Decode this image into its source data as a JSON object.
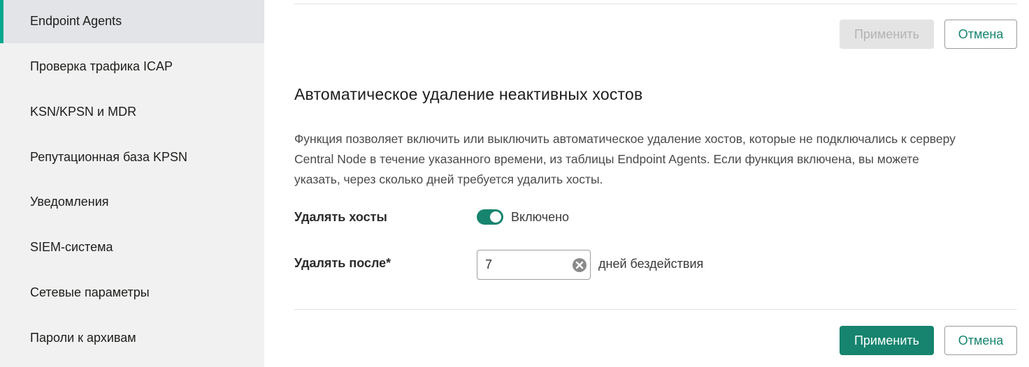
{
  "sidebar": {
    "items": [
      {
        "label": "Endpoint Agents",
        "active": true
      },
      {
        "label": "Проверка трафика ICAP"
      },
      {
        "label": "KSN/KPSN и MDR"
      },
      {
        "label": "Репутационная база KPSN"
      },
      {
        "label": "Уведомления"
      },
      {
        "label": "SIEM-система"
      },
      {
        "label": "Сетевые параметры"
      },
      {
        "label": "Пароли к архивам"
      }
    ]
  },
  "top_actions": {
    "apply_label": "Применить",
    "apply_state": "disabled",
    "cancel_label": "Отмена"
  },
  "section": {
    "title": "Автоматическое удаление неактивных хостов",
    "description_lines": [
      "Функция позволяет включить или выключить автоматическое удаление хостов, которые не подключались к серверу",
      "Central Node в течение указанного времени, из таблицы Endpoint Agents. Если функция включена, вы можете",
      "указать, через сколько дней требуется удалить хосты."
    ],
    "delete_hosts": {
      "label": "Удалять хосты",
      "toggle_on": true,
      "toggle_text": "Включено"
    },
    "delete_after": {
      "label": "Удалять после*",
      "value": "7",
      "unit": "дней бездействия"
    }
  },
  "bottom_actions": {
    "apply_label": "Применить",
    "cancel_label": "Отмена"
  },
  "colors": {
    "accent": "#16846e",
    "active_marker": "#00a88e",
    "sidebar_bg": "#f1f1f1",
    "sidebar_active_bg": "#e2e4e8"
  }
}
